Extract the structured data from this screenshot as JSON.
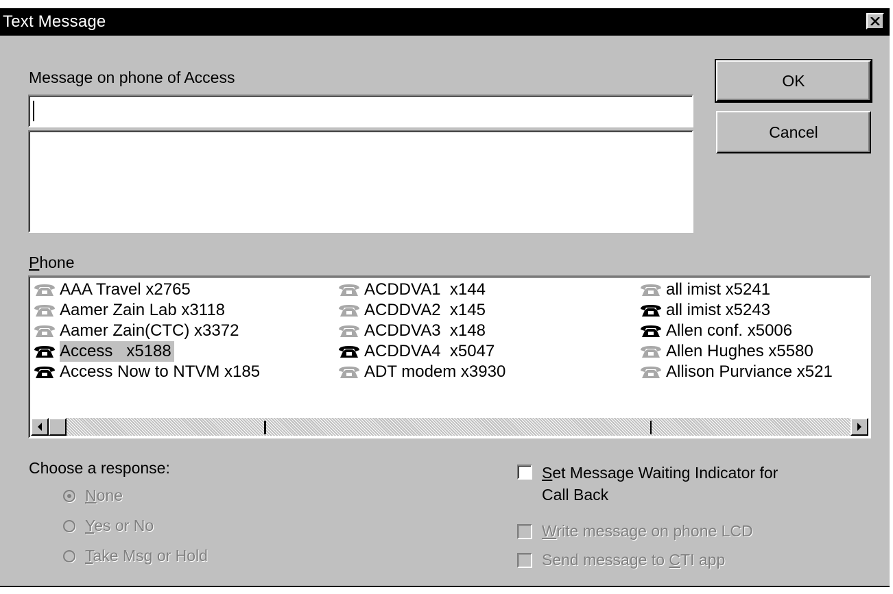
{
  "dialog": {
    "title": "Text Message",
    "message_label": "Message on phone of Access",
    "message_input_value": "",
    "message_body_value": "",
    "ok_label": "OK",
    "cancel_label": "Cancel",
    "phone_label_mnemonic": "P",
    "phone_label_rest": "hone",
    "response_label": "Choose a response:"
  },
  "phone_list": {
    "columns": [
      [
        {
          "label": "AAA Travel x2765",
          "status": "inactive"
        },
        {
          "label": "Aamer Zain Lab x3118",
          "status": "inactive"
        },
        {
          "label": "Aamer Zain(CTC) x3372",
          "status": "inactive"
        },
        {
          "label": "Access   x5188",
          "status": "active",
          "selected": true
        },
        {
          "label": "Access Now to NTVM x185",
          "status": "active"
        }
      ],
      [
        {
          "label": "ACDDVA1  x144",
          "status": "inactive"
        },
        {
          "label": "ACDDVA2  x145",
          "status": "inactive"
        },
        {
          "label": "ACDDVA3  x148",
          "status": "inactive"
        },
        {
          "label": "ACDDVA4  x5047",
          "status": "active"
        },
        {
          "label": "ADT modem x3930",
          "status": "inactive"
        }
      ],
      [
        {
          "label": "all imist x5241",
          "status": "inactive"
        },
        {
          "label": "all imist x5243",
          "status": "active"
        },
        {
          "label": "Allen conf. x5006",
          "status": "active"
        },
        {
          "label": "Allen Hughes x5580",
          "status": "inactive"
        },
        {
          "label": "Allison Purviance x521",
          "status": "inactive"
        }
      ]
    ]
  },
  "responses": [
    {
      "mnemonic": "N",
      "rest": "one",
      "checked": true
    },
    {
      "mnemonic": "Y",
      "rest": "es or No",
      "checked": false
    },
    {
      "mnemonic": "T",
      "rest": "ake Msg or Hold",
      "checked": false
    }
  ],
  "options": {
    "mwi": {
      "mnemonic": "S",
      "rest": "et Message Waiting Indicator for",
      "line2": "Call Back"
    },
    "lcd": {
      "mnemonic": "W",
      "rest": "rite message on phone LCD"
    },
    "cti": {
      "prefix": "Send message to ",
      "mnemonic": "C",
      "rest": "TI app"
    }
  },
  "colors": {
    "face": "#c0c0c0",
    "active_phone": "#000000",
    "inactive_phone": "#a8a8a8",
    "disabled_text": "#808080"
  },
  "icons": {
    "phone": "phone-icon",
    "close": "close-icon",
    "scroll_left": "arrow-left-icon",
    "scroll_right": "arrow-right-icon"
  }
}
